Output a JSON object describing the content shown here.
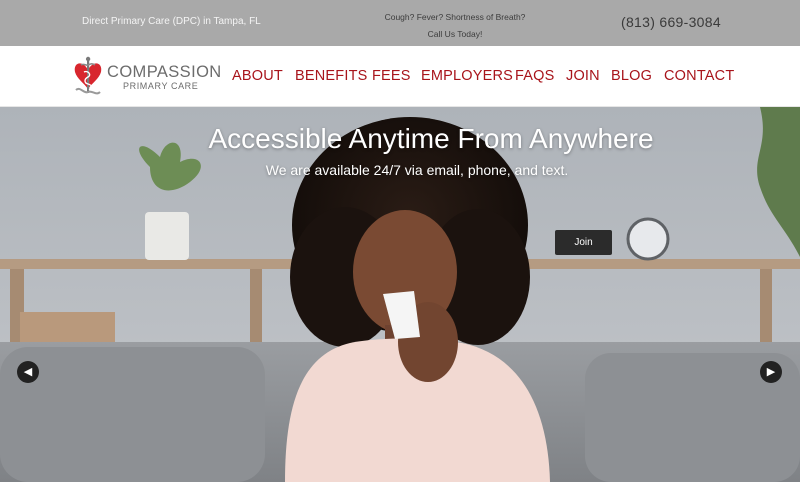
{
  "topbar": {
    "tagline": "Direct Primary Care (DPC) in Tampa, FL",
    "symptoms_line1": "Cough? Fever? Shortness of Breath?",
    "symptoms_line2": "Call Us Today!",
    "phone": "(813) 669-3084"
  },
  "logo": {
    "name": "COMPASSION",
    "subtitle": "PRIMARY CARE",
    "icon": "heart-caduceus-icon"
  },
  "nav": {
    "items": [
      {
        "label": "ABOUT"
      },
      {
        "label": "BENEFITS"
      },
      {
        "label": "FEES"
      },
      {
        "label": "EMPLOYERS"
      },
      {
        "label": "FAQS"
      },
      {
        "label": "JOIN"
      },
      {
        "label": "BLOG"
      },
      {
        "label": "CONTACT"
      }
    ]
  },
  "hero": {
    "title": "Accessible Anytime From Anywhere",
    "subtitle": "We are available 24/7 via email, phone, and text.",
    "button": "Join",
    "prev_icon": "chevron-left-icon",
    "next_icon": "chevron-right-icon"
  },
  "colors": {
    "topbar_bg": "#a9a9a9",
    "nav_text": "#a8141b",
    "button_bg": "#2b2b2b",
    "logo_red": "#d8262e"
  }
}
